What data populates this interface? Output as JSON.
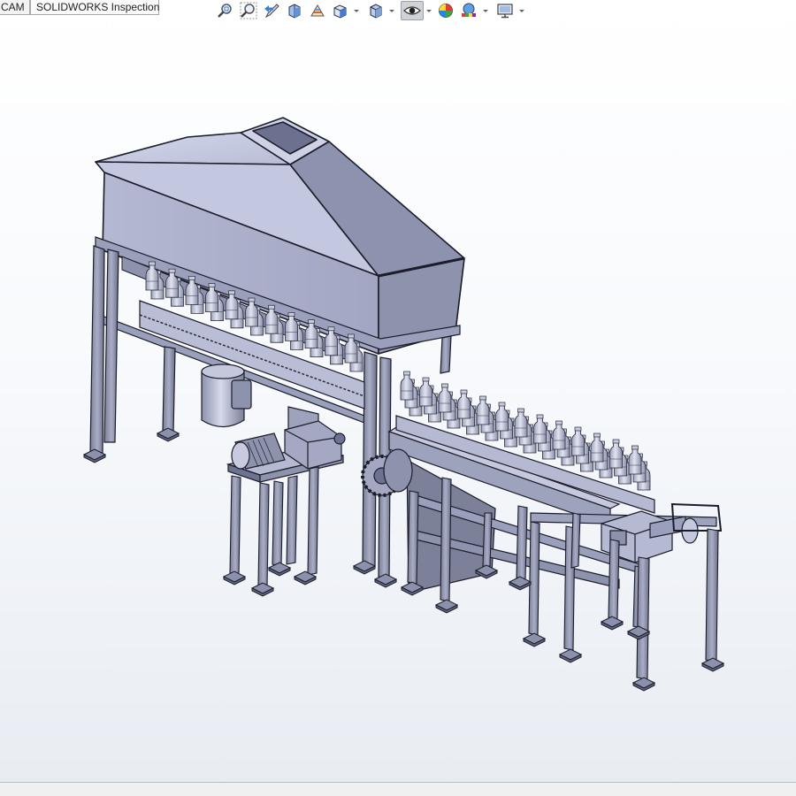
{
  "command_manager": {
    "tabs": [
      {
        "label": "CAM"
      },
      {
        "label": "SOLIDWORKS Inspection"
      }
    ]
  },
  "heads_up_toolbar": {
    "buttons": [
      {
        "icon": "zoom-to-fit-icon"
      },
      {
        "icon": "zoom-to-area-icon"
      },
      {
        "icon": "previous-view-icon"
      },
      {
        "icon": "section-view-icon"
      },
      {
        "icon": "dynamic-annotation-views-icon"
      },
      {
        "icon": "view-orientation-icon"
      },
      {
        "icon": "display-style-icon"
      },
      {
        "icon": "hide-show-items-icon"
      },
      {
        "icon": "edit-appearance-icon"
      },
      {
        "icon": "apply-scene-icon"
      },
      {
        "icon": "view-settings-icon"
      }
    ],
    "active_button": "hide-show-items-icon"
  },
  "colors": {
    "model_light": "#c5c9de",
    "model_mid": "#9ea3bd",
    "model_dark": "#6d7290",
    "edge": "#1b1d2a",
    "icon_blue": "#3d7fd6",
    "viewport_top": "#ffffff",
    "viewport_bottom": "#e8ecf2"
  }
}
